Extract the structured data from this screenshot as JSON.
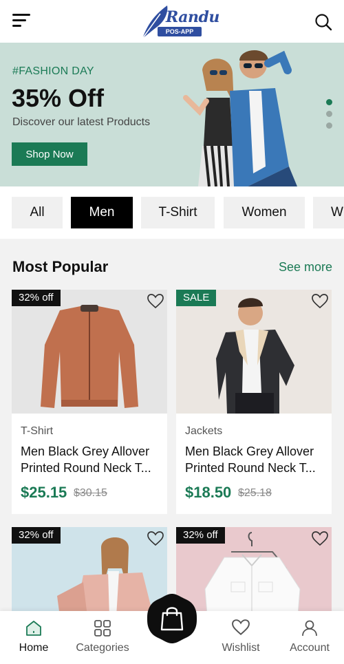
{
  "header": {
    "logo_text": "Randu",
    "logo_sub": "POS-APP"
  },
  "banner": {
    "tag": "#FASHION DAY",
    "headline": "35% Off",
    "subline": "Discover our latest Products",
    "cta": "Shop Now",
    "slide_count": 3,
    "active_slide": 1
  },
  "categories": [
    "All",
    "Men",
    "T-Shirt",
    "Women",
    "Wi"
  ],
  "active_category": "Men",
  "section": {
    "title": "Most Popular",
    "see_more": "See more"
  },
  "products": [
    {
      "badge": "32% off",
      "category": "T-Shirt",
      "name_line1": "Men Black Grey Allover",
      "name_line2": "Printed Round Neck T...",
      "price": "$25.15",
      "old_price": "$30.15"
    },
    {
      "badge": "SALE",
      "category": "Jackets",
      "name_line1": "Men Black Grey Allover",
      "name_line2": "Printed Round Neck T...",
      "price": "$18.50",
      "old_price": "$25.18"
    },
    {
      "badge": "32% off"
    },
    {
      "badge": "32% off"
    }
  ],
  "nav": {
    "home": "Home",
    "categories": "Categories",
    "wishlist": "Wishlist",
    "account": "Account"
  },
  "colors": {
    "accent": "#1b7a55",
    "brand": "#2f4ea0",
    "banner_bg": "#c9ded7"
  }
}
